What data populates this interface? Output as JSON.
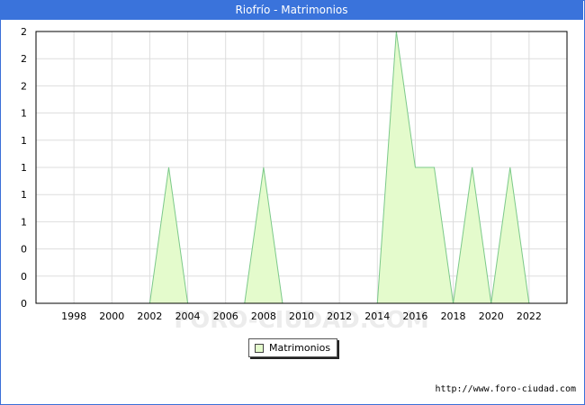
{
  "title": "Riofrío - Matrimonios",
  "watermark": "FORO-CIUDAD.COM",
  "source": "http://www.foro-ciudad.com",
  "colors": {
    "title_bg": "#3a73db",
    "fill": "#e4fbcc",
    "line": "#7cc98a",
    "grid": "#dddddd"
  },
  "chart_data": {
    "type": "area",
    "title": "Riofrío - Matrimonios",
    "x_tick_labels": [
      "1998",
      "2000",
      "2002",
      "2004",
      "2006",
      "2008",
      "2010",
      "2012",
      "2014",
      "2016",
      "2018",
      "2020",
      "2022"
    ],
    "y_tick_labels": [
      "0",
      "0",
      "0",
      "1",
      "1",
      "1",
      "1",
      "1",
      "2",
      "2",
      "2"
    ],
    "ylim": [
      0,
      2
    ],
    "xlim": [
      1996,
      2024
    ],
    "grid": true,
    "legend_position": "bottom",
    "series": [
      {
        "name": "Matrimonios",
        "x": [
          1996,
          1997,
          1998,
          1999,
          2000,
          2001,
          2002,
          2003,
          2004,
          2005,
          2006,
          2007,
          2008,
          2009,
          2010,
          2011,
          2012,
          2013,
          2014,
          2015,
          2016,
          2017,
          2018,
          2019,
          2020,
          2021,
          2022
        ],
        "values": [
          0,
          0,
          0,
          0,
          0,
          0,
          0,
          1,
          0,
          0,
          0,
          0,
          1,
          0,
          0,
          0,
          0,
          0,
          0,
          2,
          1,
          1,
          0,
          1,
          0,
          1,
          0
        ]
      }
    ]
  }
}
